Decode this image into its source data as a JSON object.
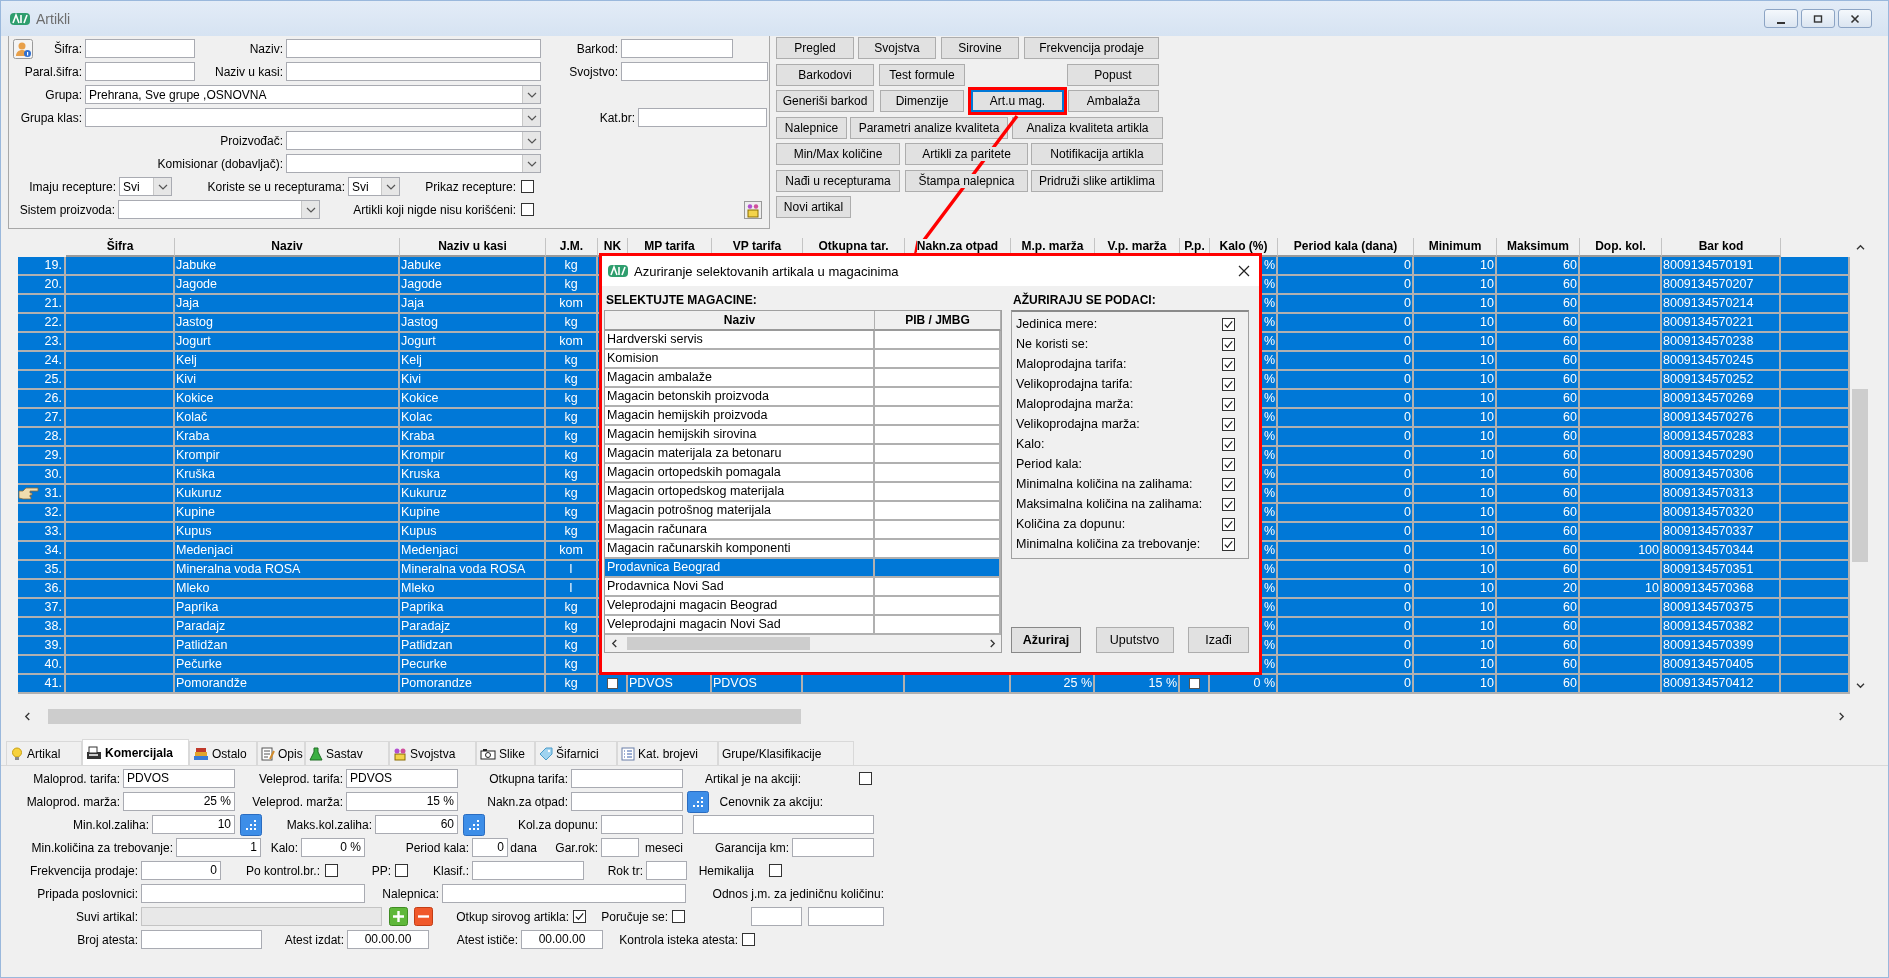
{
  "window": {
    "title": "Artikli"
  },
  "filter": {
    "items": [
      {
        "kind": "label",
        "text": "Šifra:"
      },
      {
        "kind": "input"
      },
      {
        "kind": "label",
        "text": "Naziv:"
      },
      {
        "kind": "input"
      },
      {
        "kind": "label",
        "text": "Barkod:"
      },
      {
        "kind": "input"
      },
      {
        "kind": "label",
        "text": "Paral.šifra:"
      },
      {
        "kind": "input"
      },
      {
        "kind": "label",
        "text": "Naziv u kasi:"
      },
      {
        "kind": "input"
      },
      {
        "kind": "label",
        "text": "Svojstvo:"
      },
      {
        "kind": "input"
      },
      {
        "kind": "label",
        "text": "Grupa:"
      },
      {
        "kind": "combo",
        "value": "Prehrana, Sve grupe ,OSNOVNA"
      },
      {
        "kind": "label",
        "text": "Grupa klas:"
      },
      {
        "kind": "combo"
      },
      {
        "kind": "label",
        "text": "Kat.br:"
      },
      {
        "kind": "input"
      },
      {
        "kind": "label",
        "text": "Proizvođač:"
      },
      {
        "kind": "combo"
      },
      {
        "kind": "label",
        "text": "Komisionar (dobavljač):"
      },
      {
        "kind": "combo"
      },
      {
        "kind": "label",
        "text": "Imaju recepture:"
      },
      {
        "kind": "combo",
        "value": "Svi"
      },
      {
        "kind": "label",
        "text": "Koriste se u recepturama:"
      },
      {
        "kind": "combo",
        "value": "Svi"
      },
      {
        "kind": "label",
        "text": "Prikaz recepture:"
      },
      {
        "kind": "checkbox",
        "checked": false
      },
      {
        "kind": "label",
        "text": "Sistem proizvoda:"
      },
      {
        "kind": "combo"
      },
      {
        "kind": "label",
        "text": "Artikli koji nigde nisu korišćeni:"
      },
      {
        "kind": "checkbox",
        "checked": false
      }
    ]
  },
  "actions": [
    [
      {
        "label": "Pregled",
        "focused": false
      },
      {
        "label": "Svojstva",
        "focused": false
      },
      {
        "label": "Sirovine",
        "focused": false
      },
      {
        "label": "Frekvencija prodaje",
        "focused": false
      }
    ],
    [
      {
        "label": "Barkodovi",
        "focused": false
      },
      {
        "label": "Test formule",
        "focused": false
      },
      {
        "label": "Popust",
        "focused": false
      }
    ],
    [
      {
        "label": "Generiši barkod",
        "focused": false
      },
      {
        "label": "Dimenzije",
        "focused": false
      },
      {
        "label": "Art.u mag.",
        "focused": true
      },
      {
        "label": "Ambalaža",
        "focused": false
      }
    ],
    [
      {
        "label": "Nalepnice",
        "focused": false
      },
      {
        "label": "Parametri analize kvaliteta",
        "focused": false
      },
      {
        "label": "Analiza kvaliteta artikla",
        "focused": false
      }
    ],
    [
      {
        "label": "Min/Max količine",
        "focused": false
      },
      {
        "label": "Artikli za paritete",
        "focused": false
      },
      {
        "label": "Notifikacija artikla",
        "focused": false
      }
    ],
    [
      {
        "label": "Nađi u recepturama",
        "focused": false
      },
      {
        "label": "Štampa nalepnica",
        "focused": false
      },
      {
        "label": "Pridruži slike artiklima",
        "focused": false
      }
    ],
    [
      {
        "label": "Novi artikal",
        "focused": false
      }
    ]
  ],
  "table": {
    "columns": [
      "Šifra",
      "Naziv",
      "Naziv u kasi",
      "J.M.",
      "NK",
      "MP tarifa",
      "VP tarifa",
      "Otkupna tar.",
      "Nakn.za otpad",
      "M.p. marža",
      "V.p. marža",
      "P.p.",
      "Kalo (%)",
      "Period kala (dana)",
      "Minimum",
      "Maksimum",
      "Dop. kol.",
      "Bar kod"
    ],
    "rows": [
      {
        "no": "19.",
        "naziv": "Jabuke",
        "naziv_u_kasi": "Jabuke",
        "jm": "kg",
        "kalo": "%",
        "period_kala": "0",
        "minimum": "10",
        "maksimum": "60",
        "bar_kod": "8009134570191",
        "selected": true,
        "current": false
      },
      {
        "no": "20.",
        "naziv": "Jagode",
        "naziv_u_kasi": "Jagode",
        "jm": "kg",
        "kalo": "%",
        "period_kala": "0",
        "minimum": "10",
        "maksimum": "60",
        "bar_kod": "8009134570207",
        "selected": true,
        "current": false
      },
      {
        "no": "21.",
        "naziv": "Jaja",
        "naziv_u_kasi": "Jaja",
        "jm": "kom",
        "kalo": "%",
        "period_kala": "0",
        "minimum": "10",
        "maksimum": "60",
        "bar_kod": "8009134570214",
        "selected": true,
        "current": false
      },
      {
        "no": "22.",
        "naziv": "Jastog",
        "naziv_u_kasi": "Jastog",
        "jm": "kg",
        "kalo": "%",
        "period_kala": "0",
        "minimum": "10",
        "maksimum": "60",
        "bar_kod": "8009134570221",
        "selected": true,
        "current": false
      },
      {
        "no": "23.",
        "naziv": "Jogurt",
        "naziv_u_kasi": "Jogurt",
        "jm": "kom",
        "kalo": "%",
        "period_kala": "0",
        "minimum": "10",
        "maksimum": "60",
        "bar_kod": "8009134570238",
        "selected": true,
        "current": false
      },
      {
        "no": "24.",
        "naziv": "Kelj",
        "naziv_u_kasi": "Kelj",
        "jm": "kg",
        "kalo": "%",
        "period_kala": "0",
        "minimum": "10",
        "maksimum": "60",
        "bar_kod": "8009134570245",
        "selected": true,
        "current": false
      },
      {
        "no": "25.",
        "naziv": "Kivi",
        "naziv_u_kasi": "Kivi",
        "jm": "kg",
        "kalo": "%",
        "period_kala": "0",
        "minimum": "10",
        "maksimum": "60",
        "bar_kod": "8009134570252",
        "selected": true,
        "current": false
      },
      {
        "no": "26.",
        "naziv": "Kokice",
        "naziv_u_kasi": "Kokice",
        "jm": "kg",
        "kalo": "%",
        "period_kala": "0",
        "minimum": "10",
        "maksimum": "60",
        "bar_kod": "8009134570269",
        "selected": true,
        "current": false
      },
      {
        "no": "27.",
        "naziv": "Kolač",
        "naziv_u_kasi": "Kolac",
        "jm": "kg",
        "kalo": "%",
        "period_kala": "0",
        "minimum": "10",
        "maksimum": "60",
        "bar_kod": "8009134570276",
        "selected": true,
        "current": false
      },
      {
        "no": "28.",
        "naziv": "Kraba",
        "naziv_u_kasi": "Kraba",
        "jm": "kg",
        "kalo": "%",
        "period_kala": "0",
        "minimum": "10",
        "maksimum": "60",
        "bar_kod": "8009134570283",
        "selected": true,
        "current": false
      },
      {
        "no": "29.",
        "naziv": "Krompir",
        "naziv_u_kasi": "Krompir",
        "jm": "kg",
        "kalo": "%",
        "period_kala": "0",
        "minimum": "10",
        "maksimum": "60",
        "bar_kod": "8009134570290",
        "selected": true,
        "current": false
      },
      {
        "no": "30.",
        "naziv": "Kruška",
        "naziv_u_kasi": "Kruska",
        "jm": "kg",
        "kalo": "%",
        "period_kala": "0",
        "minimum": "10",
        "maksimum": "60",
        "bar_kod": "8009134570306",
        "selected": true,
        "current": false
      },
      {
        "no": "31.",
        "naziv": "Kukuruz",
        "naziv_u_kasi": "Kukuruz",
        "jm": "kg",
        "kalo": "%",
        "period_kala": "0",
        "minimum": "10",
        "maksimum": "60",
        "bar_kod": "8009134570313",
        "selected": true,
        "current": true
      },
      {
        "no": "32.",
        "naziv": "Kupine",
        "naziv_u_kasi": "Kupine",
        "jm": "kg",
        "kalo": "%",
        "period_kala": "0",
        "minimum": "10",
        "maksimum": "60",
        "bar_kod": "8009134570320",
        "selected": true,
        "current": false
      },
      {
        "no": "33.",
        "naziv": "Kupus",
        "naziv_u_kasi": "Kupus",
        "jm": "kg",
        "kalo": "%",
        "period_kala": "0",
        "minimum": "10",
        "maksimum": "60",
        "bar_kod": "8009134570337",
        "selected": true,
        "current": false
      },
      {
        "no": "34.",
        "naziv": "Medenjaci",
        "naziv_u_kasi": "Medenjaci",
        "jm": "kom",
        "kalo": "%",
        "period_kala": "0",
        "minimum": "10",
        "maksimum": "60",
        "dop_kol": "100",
        "bar_kod": "8009134570344",
        "selected": true,
        "current": false
      },
      {
        "no": "35.",
        "naziv": "Mineralna voda ROSA",
        "naziv_u_kasi": "Mineralna voda ROSA",
        "jm": "l",
        "kalo": "%",
        "period_kala": "0",
        "minimum": "10",
        "maksimum": "60",
        "bar_kod": "8009134570351",
        "selected": true,
        "current": false
      },
      {
        "no": "36.",
        "naziv": "Mleko",
        "naziv_u_kasi": "Mleko",
        "jm": "l",
        "kalo": "%",
        "period_kala": "0",
        "minimum": "10",
        "maksimum": "20",
        "dop_kol": "10",
        "bar_kod": "8009134570368",
        "selected": true,
        "current": false
      },
      {
        "no": "37.",
        "naziv": "Paprika",
        "naziv_u_kasi": "Paprika",
        "jm": "kg",
        "kalo": "%",
        "period_kala": "0",
        "minimum": "10",
        "maksimum": "60",
        "bar_kod": "8009134570375",
        "selected": true,
        "current": false
      },
      {
        "no": "38.",
        "naziv": "Paradajz",
        "naziv_u_kasi": "Paradajz",
        "jm": "kg",
        "kalo": "%",
        "period_kala": "0",
        "minimum": "10",
        "maksimum": "60",
        "bar_kod": "8009134570382",
        "selected": true,
        "current": false
      },
      {
        "no": "39.",
        "naziv": "Patlidžan",
        "naziv_u_kasi": "Patlidzan",
        "jm": "kg",
        "kalo": "%",
        "period_kala": "0",
        "minimum": "10",
        "maksimum": "60",
        "bar_kod": "8009134570399",
        "selected": true,
        "current": false
      },
      {
        "no": "40.",
        "naziv": "Pečurke",
        "naziv_u_kasi": "Pecurke",
        "jm": "kg",
        "kalo": "%",
        "period_kala": "0",
        "minimum": "10",
        "maksimum": "60",
        "bar_kod": "8009134570405",
        "selected": true,
        "current": false
      },
      {
        "no": "41.",
        "naziv": "Pomorandže",
        "naziv_u_kasi": "Pomorandze",
        "jm": "kg",
        "nk": false,
        "mp_tarifa": "PDVOS",
        "vp_tarifa": "PDVOS",
        "mp_marza": "25 %",
        "vp_marza": "15 %",
        "pp": false,
        "kalo": "0 %",
        "period_kala": "0",
        "minimum": "10",
        "maksimum": "60",
        "bar_kod": "8009134570412",
        "selected": true,
        "current": false
      }
    ]
  },
  "dialog": {
    "title": "Azuriranje selektovanih artikala u magacinima",
    "left_heading": "SELEKTUJTE MAGACINE:",
    "columns": [
      "Naziv",
      "PIB / JMBG"
    ],
    "warehouses": [
      {
        "name": "Hardverski servis",
        "selected": false
      },
      {
        "name": "Komision",
        "selected": false
      },
      {
        "name": "Magacin ambalaže",
        "selected": false
      },
      {
        "name": "Magacin betonskih proizvoda",
        "selected": false
      },
      {
        "name": "Magacin hemijskih proizvoda",
        "selected": false
      },
      {
        "name": "Magacin hemijskih sirovina",
        "selected": false
      },
      {
        "name": "Magacin materijala za betonaru",
        "selected": false
      },
      {
        "name": "Magacin ortopedskih pomagala",
        "selected": false
      },
      {
        "name": "Magacin ortopedskog materijala",
        "selected": false
      },
      {
        "name": "Magacin potrošnog materijala",
        "selected": false
      },
      {
        "name": "Magacin računara",
        "selected": false
      },
      {
        "name": "Magacin računarskih komponenti",
        "selected": false
      },
      {
        "name": "Prodavnica Beograd",
        "selected": true
      },
      {
        "name": "Prodavnica Novi Sad",
        "selected": false
      },
      {
        "name": "Veleprodajni magacin Beograd",
        "selected": false
      },
      {
        "name": "Veleprodajni magacin Novi Sad",
        "selected": false
      }
    ],
    "right_heading": "AŽURIRAJU SE PODACI:",
    "fields": [
      {
        "label": "Jedinica mere:",
        "checked": true
      },
      {
        "label": "Ne koristi se:",
        "checked": true
      },
      {
        "label": "Maloprodajna tarifa:",
        "checked": true
      },
      {
        "label": "Velikoprodajna tarifa:",
        "checked": true
      },
      {
        "label": "Maloprodajna marža:",
        "checked": true
      },
      {
        "label": "Velikoprodajna marža:",
        "checked": true
      },
      {
        "label": "Kalo:",
        "checked": true
      },
      {
        "label": "Period kala:",
        "checked": true
      },
      {
        "label": "Minimalna količina na zalihama:",
        "checked": true
      },
      {
        "label": "Maksimalna količina na zalihama:",
        "checked": true
      },
      {
        "label": "Količina za dopunu:",
        "checked": true
      },
      {
        "label": "Minimalna količina za trebovanje:",
        "checked": true
      }
    ],
    "buttons": [
      {
        "label": "Ažuriraj",
        "default": true
      },
      {
        "label": "Uputstvo",
        "default": false
      },
      {
        "label": "Izađi",
        "default": false
      }
    ]
  },
  "tabs": [
    {
      "label": "Artikal",
      "selected": false
    },
    {
      "label": "Komercijala",
      "selected": true
    },
    {
      "label": "Ostalo",
      "selected": false
    },
    {
      "label": "Opis",
      "selected": false
    },
    {
      "label": "Sastav",
      "selected": false
    },
    {
      "label": "Svojstva",
      "selected": false
    },
    {
      "label": "Slike",
      "selected": false
    },
    {
      "label": "Šifarnici",
      "selected": false
    },
    {
      "label": "Kat. brojevi",
      "selected": false
    },
    {
      "label": "Grupe/Klasifikacije",
      "selected": false
    }
  ],
  "form": {
    "items": [
      {
        "kind": "label",
        "text": "Maloprod. tarifa:"
      },
      {
        "kind": "input",
        "value": "PDVOS"
      },
      {
        "kind": "label",
        "text": "Veleprod. tarifa:"
      },
      {
        "kind": "input",
        "value": "PDVOS"
      },
      {
        "kind": "label",
        "text": "Otkupna tarifa:"
      },
      {
        "kind": "input"
      },
      {
        "kind": "label",
        "text": "Artikal je na akciji:"
      },
      {
        "kind": "checkbox",
        "checked": false
      },
      {
        "kind": "label",
        "text": "Maloprod. marža:"
      },
      {
        "kind": "number",
        "value": "25 %"
      },
      {
        "kind": "label",
        "text": "Veleprod. marža:"
      },
      {
        "kind": "number",
        "value": "15 %"
      },
      {
        "kind": "label",
        "text": "Nakn.za otpad:"
      },
      {
        "kind": "input"
      },
      {
        "kind": "picker"
      },
      {
        "kind": "label",
        "text": "Cenovnik za akciju:"
      },
      {
        "kind": "label",
        "text": "Min.kol.zaliha:"
      },
      {
        "kind": "number",
        "value": "10"
      },
      {
        "kind": "picker"
      },
      {
        "kind": "label",
        "text": "Maks.kol.zaliha:"
      },
      {
        "kind": "number",
        "value": "60"
      },
      {
        "kind": "picker"
      },
      {
        "kind": "label",
        "text": "Kol.za dopunu:"
      },
      {
        "kind": "input"
      },
      {
        "kind": "input"
      },
      {
        "kind": "label",
        "text": "Min.količina za trebovanje:"
      },
      {
        "kind": "number",
        "value": "1"
      },
      {
        "kind": "label",
        "text": "Kalo:"
      },
      {
        "kind": "number",
        "value": "0 %"
      },
      {
        "kind": "label",
        "text": "Period kala:"
      },
      {
        "kind": "number",
        "value": "0"
      },
      {
        "kind": "label",
        "text": "dana"
      },
      {
        "kind": "label",
        "text": "Gar.rok:"
      },
      {
        "kind": "input"
      },
      {
        "kind": "label",
        "text": "meseci"
      },
      {
        "kind": "label",
        "text": "Garancija km:"
      },
      {
        "kind": "input"
      },
      {
        "kind": "label",
        "text": "Frekvencija prodaje:"
      },
      {
        "kind": "number",
        "value": "0"
      },
      {
        "kind": "label",
        "text": "Po kontrol.br.:"
      },
      {
        "kind": "checkbox",
        "checked": false
      },
      {
        "kind": "label",
        "text": "PP:"
      },
      {
        "kind": "checkbox",
        "checked": false
      },
      {
        "kind": "label",
        "text": "Klasif.:"
      },
      {
        "kind": "input"
      },
      {
        "kind": "label",
        "text": "Rok tr:"
      },
      {
        "kind": "input"
      },
      {
        "kind": "label",
        "text": "Hemikalija"
      },
      {
        "kind": "checkbox",
        "checked": false
      },
      {
        "kind": "label",
        "text": "Pripada poslovnici:"
      },
      {
        "kind": "input"
      },
      {
        "kind": "label",
        "text": "Nalepnica:"
      },
      {
        "kind": "input"
      },
      {
        "kind": "label",
        "text": "Odnos j.m. za jediničnu količinu:"
      },
      {
        "kind": "label",
        "text": "Suvi artikal:"
      },
      {
        "kind": "locked"
      },
      {
        "kind": "add"
      },
      {
        "kind": "remove"
      },
      {
        "kind": "label",
        "text": "Otkup sirovog artikla:"
      },
      {
        "kind": "checkbox",
        "checked": true
      },
      {
        "kind": "label",
        "text": "Poručuje se:"
      },
      {
        "kind": "checkbox",
        "checked": false
      },
      {
        "kind": "input"
      },
      {
        "kind": "input"
      },
      {
        "kind": "label",
        "text": "Broj atesta:"
      },
      {
        "kind": "input"
      },
      {
        "kind": "label",
        "text": "Atest izdat:"
      },
      {
        "kind": "date",
        "value": "00.00.00"
      },
      {
        "kind": "label",
        "text": "Atest ističe:"
      },
      {
        "kind": "date",
        "value": "00.00.00"
      },
      {
        "kind": "label",
        "text": "Kontrola isteka atesta:"
      },
      {
        "kind": "checkbox",
        "checked": false
      }
    ]
  }
}
